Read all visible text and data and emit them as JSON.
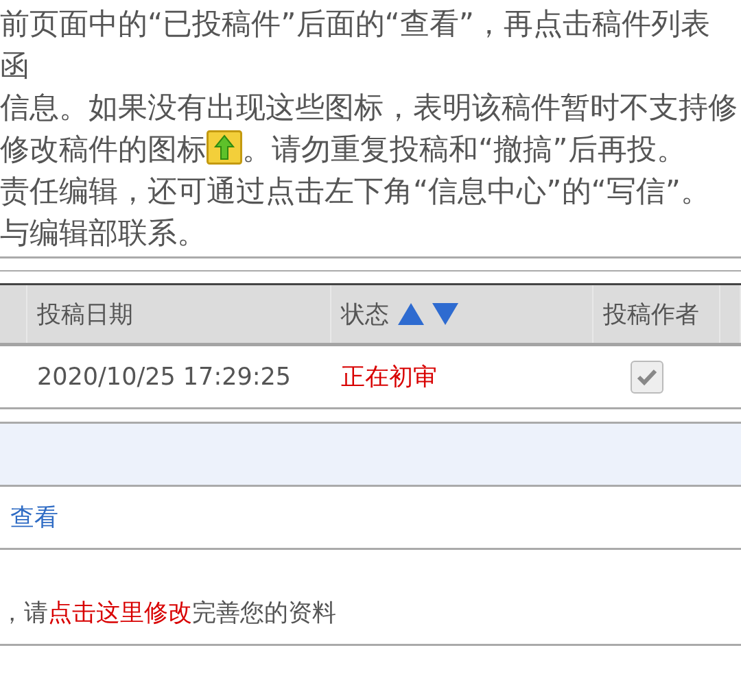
{
  "instructions": [
    {
      "kind": "text",
      "text": "前页面中的“已投稿件”后面的“查看”，再点击稿件列表"
    },
    {
      "kind": "text",
      "text": "函"
    },
    {
      "kind": "text",
      "text": "信息。如果没有出现这些图标，表明该稿件暂时不支持修"
    },
    {
      "kind": "icon",
      "before": "修改稿件的图标",
      "after": "。请勿重复投稿和“撤搞”后再投。"
    },
    {
      "kind": "text",
      "text": "责任编辑，还可通过点击左下角“信息中心”的“写信”。"
    },
    {
      "kind": "text",
      "text": "与编辑部联系。"
    }
  ],
  "table": {
    "columns": [
      {
        "label": "投稿日期",
        "sortable": false
      },
      {
        "label": "状态",
        "sortable": true
      },
      {
        "label": "投稿作者",
        "sortable": false
      }
    ],
    "rows": [
      {
        "date": "2020/10/25 17:29:25",
        "status": "正在初审",
        "author_checked": true,
        "disabled": true
      }
    ]
  },
  "view_link": "查看",
  "notice": {
    "before": "，请",
    "link": "点击这里修改",
    "after": "完善您的资料"
  }
}
